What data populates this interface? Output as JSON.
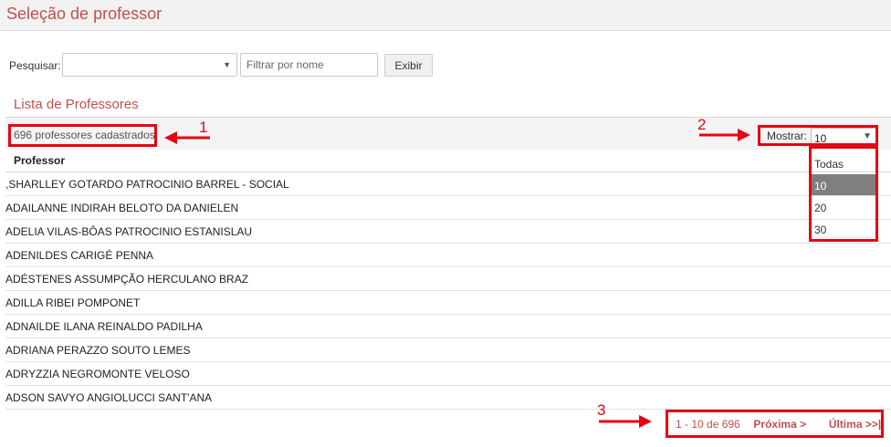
{
  "page": {
    "title": "Seleção de professor"
  },
  "search": {
    "label": "Pesquisar:",
    "select_value": "",
    "filter_placeholder": "Filtrar por nome",
    "button_label": "Exibir"
  },
  "list": {
    "title": "Lista de Professores",
    "count_text": "696 professores cadastrados",
    "show_label": "Mostrar:",
    "page_size": {
      "selected": "10",
      "options": [
        {
          "label": "Todas",
          "active": false
        },
        {
          "label": "10",
          "active": true
        },
        {
          "label": "20",
          "active": false
        },
        {
          "label": "30",
          "active": false
        }
      ]
    },
    "column_header": "Professor",
    "rows": [
      ",SHARLLEY GOTARDO PATROCINIO BARREL - SOCIAL",
      "ADAILANNE INDIRAH BELOTO DA DANIELEN",
      "ADELIA VILAS-BÔAS PATROCINIO ESTANISLAU",
      "ADENILDES CARIGÉ PENNA",
      "ADÉSTENES ASSUMPÇÃO HERCULANO BRAZ",
      "ADILLA RIBEI POMPONET",
      "ADNAILDE ILANA REINALDO PADILHA",
      "ADRIANA PERAZZO SOUTO LEMES",
      "ADRYZZIA NEGROMONTE VELOSO",
      "ADSON SAVYO ANGIOLUCCI SANT'ANA"
    ]
  },
  "pagination": {
    "range_text": "1 - 10 de 696",
    "next_label": "Próxima >",
    "last_label": "Última >>|"
  },
  "annotations": {
    "color": "#e30613",
    "labels": [
      "1",
      "2",
      "3"
    ]
  },
  "colors": {
    "accent": "#c0504d",
    "annotation": "#e30613",
    "selected_option": "#7f7f7f"
  }
}
